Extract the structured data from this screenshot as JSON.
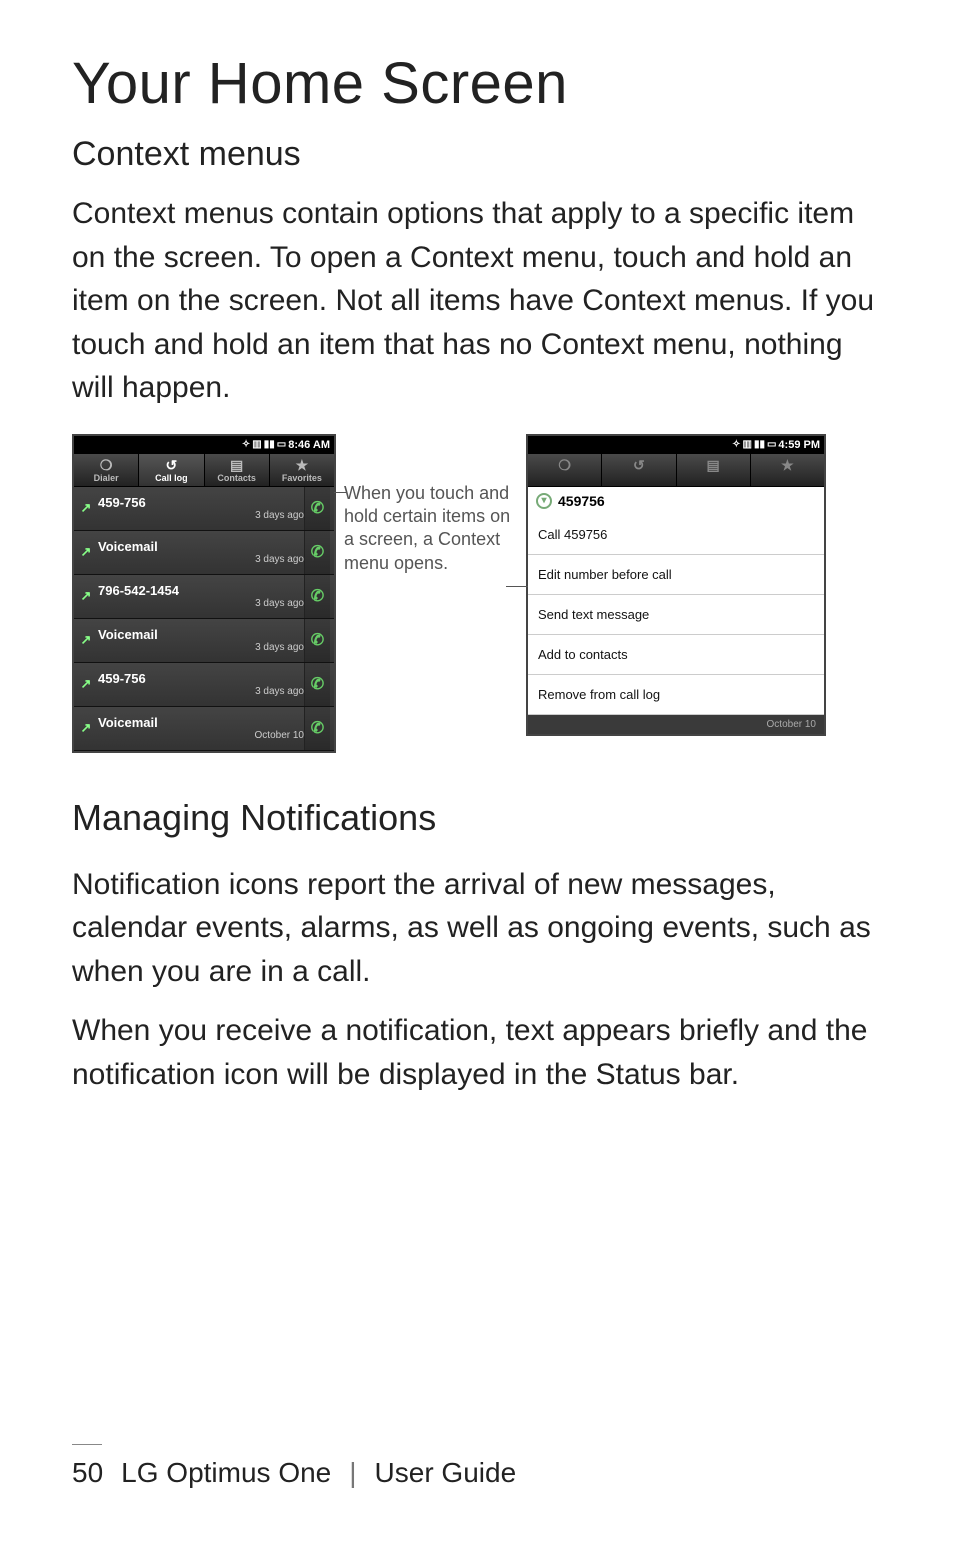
{
  "title": "Your Home Screen",
  "section1_title": "Context menus",
  "section1_body": "Context menus contain options that apply to a specific item on the screen. To open a Context menu, touch and hold an item on the screen. Not all items have Context menus. If you touch and hold an item that has no Context menu, nothing will happen.",
  "left_phone": {
    "status_time": "8:46 AM",
    "tabs": [
      {
        "label": "Dialer"
      },
      {
        "label": "Call log"
      },
      {
        "label": "Contacts"
      },
      {
        "label": "Favorites"
      }
    ],
    "active_tab_index": 1,
    "log": [
      {
        "number": "459-756",
        "ago": "3 days ago"
      },
      {
        "number": "Voicemail",
        "ago": "3 days ago"
      },
      {
        "number": "796-542-1454",
        "ago": "3 days ago"
      },
      {
        "number": "Voicemail",
        "ago": "3 days ago"
      },
      {
        "number": "459-756",
        "ago": "3 days ago"
      },
      {
        "number": "Voicemail",
        "ago": "October 10"
      }
    ]
  },
  "callout_text": "When you touch and hold certain items on a screen, a Context menu opens.",
  "right_phone": {
    "status_time": "4:59 PM",
    "header_number": "459756",
    "items": [
      "Call 459756",
      "Edit number before call",
      "Send text message",
      "Add to contacts",
      "Remove from call log"
    ],
    "footer_date": "October 10"
  },
  "section2_title": "Managing Notifications",
  "section2_body1": "Notification icons report the arrival of new messages, calendar events, alarms, as well as ongoing events, such as when you are in a call.",
  "section2_body2": "When you receive a notification, text appears briefly and the notification icon will be displayed in the Status bar.",
  "footer": {
    "page_number": "50",
    "product": "LG Optimus One",
    "separator": "|",
    "doc": "User Guide"
  }
}
